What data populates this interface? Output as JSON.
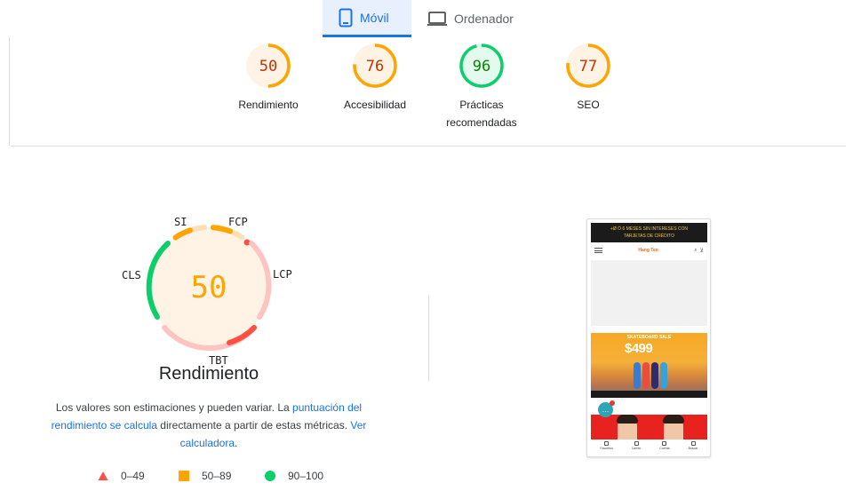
{
  "tabs": [
    {
      "label": "Móvil",
      "active": true,
      "icon": "phone-icon"
    },
    {
      "label": "Ordenador",
      "active": false,
      "icon": "laptop-icon"
    }
  ],
  "scores": [
    {
      "value": "50",
      "label": "Rendimiento",
      "status": "average"
    },
    {
      "value": "76",
      "label": "Accesibilidad",
      "status": "average"
    },
    {
      "value": "96",
      "label": "Prácticas recomendadas",
      "status": "pass"
    },
    {
      "value": "77",
      "label": "SEO",
      "status": "average"
    }
  ],
  "colors": {
    "pass": "#0cce6b",
    "pass_bg": "#e5faef",
    "pass_text": "#008800",
    "average": "#ffa400",
    "average_bg": "#fff3e6",
    "average_text": "#c33300",
    "fail": "#ff4e42",
    "fail_light": "#ffc4c0",
    "average_light": "#ffe0b3",
    "accent": "#1a73e8"
  },
  "performance": {
    "score": "50",
    "title": "Rendimiento",
    "metrics": [
      "SI",
      "FCP",
      "LCP",
      "TBT",
      "CLS"
    ],
    "description": {
      "text1": "Los valores son estimaciones y pueden variar. La ",
      "link1": "puntuación del rendimiento se calcula",
      "text2": " directamente a partir de estas métricas. ",
      "link2": "Ver calculadora",
      "text3": "."
    }
  },
  "legend": [
    {
      "shape": "triangle",
      "range": "0–49"
    },
    {
      "shape": "square",
      "range": "50–89"
    },
    {
      "shape": "circle",
      "range": "90–100"
    }
  ],
  "screenshot": {
    "promo_line1": "+Ø Ó 6 MESES SIN INTERESES CON",
    "promo_line2": "TARJETAS DE CRÉDITO",
    "logo": "Hang Ten",
    "banner_title": "SKATEBOARD SALE",
    "banner_price": "$499",
    "nav": [
      "Favoritos",
      "Carrito",
      "Cuenta",
      "Buscar"
    ]
  }
}
